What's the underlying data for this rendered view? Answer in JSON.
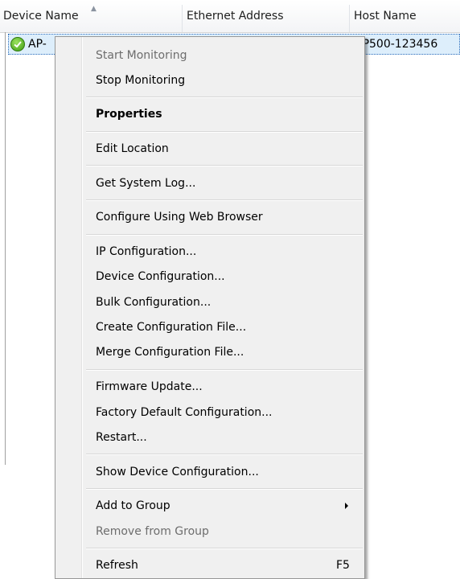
{
  "listview": {
    "columns": [
      {
        "label": "Device Name"
      },
      {
        "label": "Ethernet Address"
      },
      {
        "label": "Host Name"
      }
    ],
    "row": {
      "device_name": "AP-",
      "host_name": "AP500-123456",
      "status_icon": "green-check-icon"
    }
  },
  "context_menu": {
    "items": [
      {
        "label": "Start Monitoring",
        "enabled": false
      },
      {
        "label": "Stop Monitoring",
        "enabled": true
      },
      {
        "label": "Properties",
        "enabled": true,
        "bold": true
      },
      {
        "label": "Edit Location",
        "enabled": true
      },
      {
        "label": "Get System Log...",
        "enabled": true
      },
      {
        "label": "Configure Using Web Browser",
        "enabled": true
      },
      {
        "label": "IP Configuration...",
        "enabled": true
      },
      {
        "label": "Device Configuration...",
        "enabled": true
      },
      {
        "label": "Bulk Configuration...",
        "enabled": true
      },
      {
        "label": "Create Configuration File...",
        "enabled": true
      },
      {
        "label": "Merge Configuration File...",
        "enabled": true
      },
      {
        "label": "Firmware Update...",
        "enabled": true
      },
      {
        "label": "Factory Default Configuration...",
        "enabled": true
      },
      {
        "label": "Restart...",
        "enabled": true
      },
      {
        "label": "Show Device Configuration...",
        "enabled": true
      },
      {
        "label": "Add to Group",
        "enabled": true,
        "submenu": true
      },
      {
        "label": "Remove from Group",
        "enabled": false
      },
      {
        "label": "Refresh",
        "enabled": true,
        "shortcut": "F5"
      }
    ]
  },
  "colors": {
    "selection_bg": "#ddeefb",
    "menu_bg": "#f0f0f0",
    "disabled_text": "#6d6d6d"
  }
}
